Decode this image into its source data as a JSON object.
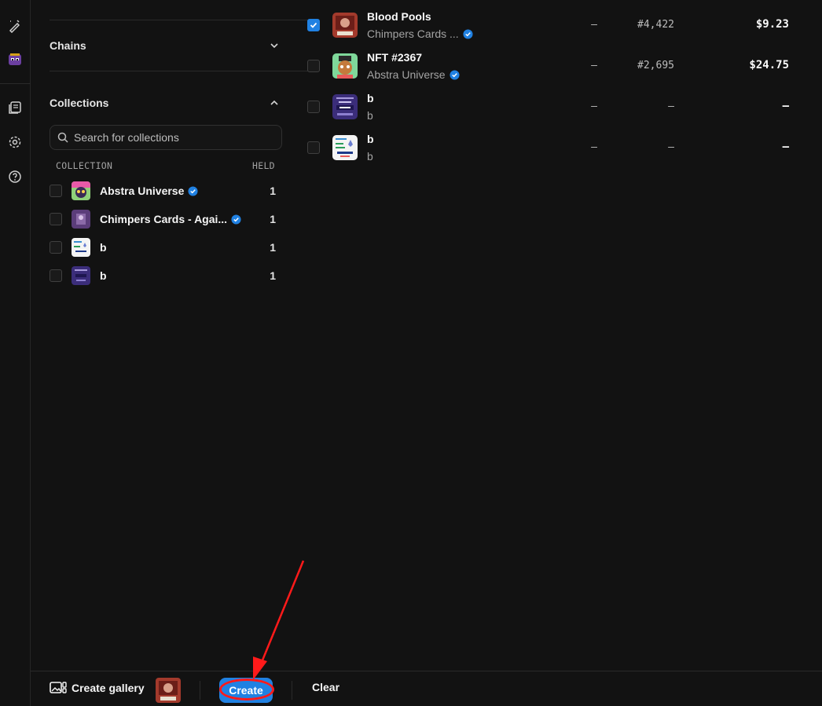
{
  "sidebar": {
    "chains_label": "Chains",
    "collections_label": "Collections",
    "search_placeholder": "Search for collections",
    "col_collection": "COLLECTION",
    "col_held": "HELD",
    "collections": [
      {
        "name": "Abstra Universe",
        "verified": true,
        "held": "1"
      },
      {
        "name": "Chimpers Cards - Agai...",
        "verified": true,
        "held": "1"
      },
      {
        "name": "b",
        "verified": false,
        "held": "1"
      },
      {
        "name": "b",
        "verified": false,
        "held": "1"
      }
    ]
  },
  "items": [
    {
      "title": "Blood Pools",
      "collection": "Chimpers Cards ...",
      "verified": true,
      "checked": true,
      "col1": "–",
      "rank": "#4,422",
      "price": "$9.23"
    },
    {
      "title": "NFT #2367",
      "collection": "Abstra Universe",
      "verified": true,
      "checked": false,
      "col1": "–",
      "rank": "#2,695",
      "price": "$24.75"
    },
    {
      "title": "b",
      "collection": "b",
      "verified": false,
      "checked": false,
      "col1": "–",
      "rank": "–",
      "price": "–"
    },
    {
      "title": "b",
      "collection": "b",
      "verified": false,
      "checked": false,
      "col1": "–",
      "rank": "–",
      "price": "–"
    }
  ],
  "bottombar": {
    "create_gallery_label": "Create gallery",
    "create_label": "Create",
    "clear_label": "Clear"
  },
  "colors": {
    "accent": "#2081e2",
    "annotation": "#ff1a1a",
    "background": "#121212"
  },
  "icons": [
    "pen-sparkle-icon",
    "avatar-icon",
    "library-icon",
    "settings-icon",
    "help-icon",
    "search-icon",
    "chevron-down-icon",
    "chevron-up-icon",
    "verified-icon",
    "gallery-icon"
  ]
}
